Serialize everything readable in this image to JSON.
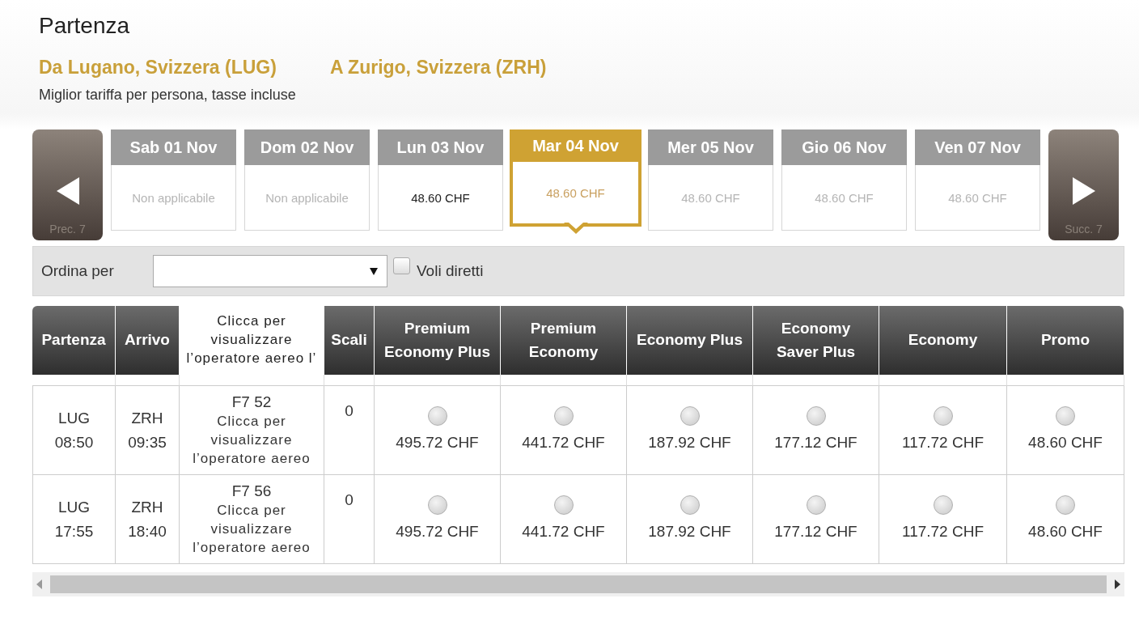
{
  "title": "Partenza",
  "route": {
    "from": "Da Lugano, Svizzera (LUG)",
    "to": "A Zurigo, Svizzera (ZRH)"
  },
  "subtitle": "Miglior tariffa per persona, tasse incluse",
  "prev_button": {
    "label": "Prec. 7"
  },
  "next_button": {
    "label": "Succ. 7"
  },
  "dates": [
    {
      "label": "Sab 01 Nov",
      "price": "Non applicabile",
      "selected": false,
      "muted": true
    },
    {
      "label": "Dom 02 Nov",
      "price": "Non applicabile",
      "selected": false,
      "muted": true
    },
    {
      "label": "Lun 03 Nov",
      "price": "48.60 CHF",
      "selected": false,
      "muted": false
    },
    {
      "label": "Mar 04 Nov",
      "price": "48.60 CHF",
      "selected": true,
      "muted": false
    },
    {
      "label": "Mer 05 Nov",
      "price": "48.60 CHF",
      "selected": false,
      "muted": true
    },
    {
      "label": "Gio 06 Nov",
      "price": "48.60 CHF",
      "selected": false,
      "muted": true
    },
    {
      "label": "Ven 07 Nov",
      "price": "48.60 CHF",
      "selected": false,
      "muted": true
    }
  ],
  "filter": {
    "sort_label": "Ordina per",
    "direct_label": "Voli diretti",
    "direct_checked": false
  },
  "table": {
    "columns": [
      "Partenza",
      "Arrivo",
      "Clicca per visualizzare l’operatore aereo l’",
      "Scali",
      "Premium Economy Plus",
      "Premium Economy",
      "Economy Plus",
      "Economy Saver Plus",
      "Economy",
      "Promo"
    ],
    "rows": [
      {
        "from": "LUG",
        "dep": "08:50",
        "to": "ZRH",
        "arr": "09:35",
        "flight": "F7 52",
        "operator": "Clicca per visualizzare l’operatore aereo",
        "stops": "0",
        "fares": [
          {
            "price": "495.72 CHF",
            "selected": false
          },
          {
            "price": "441.72 CHF",
            "selected": false
          },
          {
            "price": "187.92 CHF",
            "selected": false
          },
          {
            "price": "177.12 CHF",
            "selected": false
          },
          {
            "price": "117.72 CHF",
            "selected": false
          },
          {
            "price": "48.60 CHF",
            "selected": false
          }
        ]
      },
      {
        "from": "LUG",
        "dep": "17:55",
        "to": "ZRH",
        "arr": "18:40",
        "flight": "F7 56",
        "operator": "Clicca per visualizzare l’operatore aereo",
        "stops": "0",
        "fares": [
          {
            "price": "495.72 CHF",
            "selected": false
          },
          {
            "price": "441.72 CHF",
            "selected": false
          },
          {
            "price": "187.92 CHF",
            "selected": false
          },
          {
            "price": "177.12 CHF",
            "selected": false
          },
          {
            "price": "117.72 CHF",
            "selected": false
          },
          {
            "price": "48.60 CHF",
            "selected": false
          }
        ]
      }
    ]
  }
}
